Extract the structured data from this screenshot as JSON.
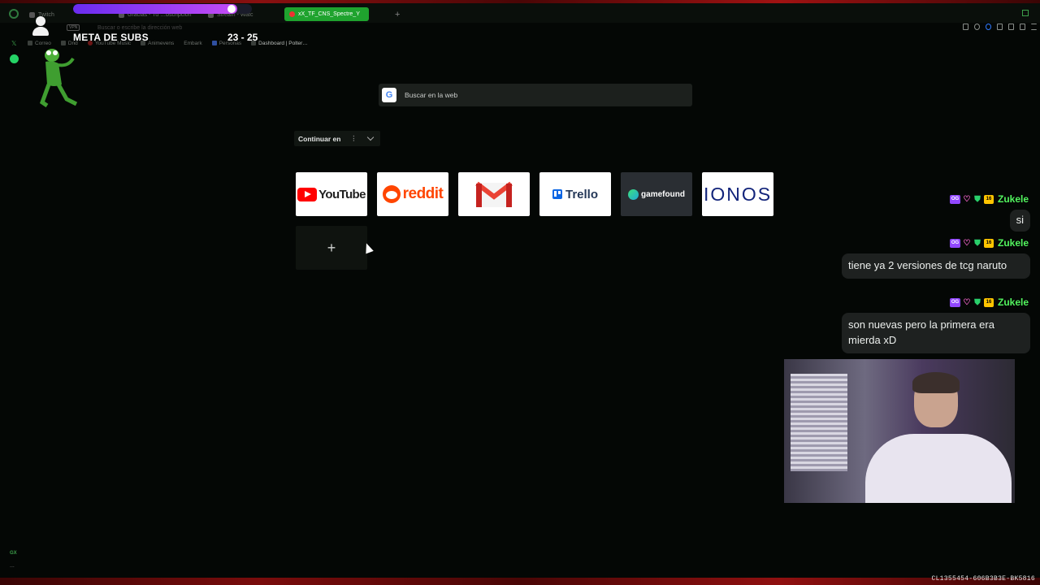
{
  "tabs": [
    {
      "label": "Twitch",
      "active": false
    },
    {
      "label": "Gracias - Tu …bscripción",
      "active": false
    },
    {
      "label": "Stream - Watc",
      "active": false
    },
    {
      "label": "xX_TF_CNS_Spectre_Y",
      "active": true
    }
  ],
  "overlay": {
    "meta_label": "META DE SUBS",
    "meta_count": "23 - 25",
    "meta_progress": 0.92
  },
  "address": {
    "vpn": "VPN",
    "placeholder": "Buscar o escribe la dirección web"
  },
  "bookmarks": [
    {
      "label": "Correo"
    },
    {
      "label": "Dnd"
    },
    {
      "label": "YouTube Music"
    },
    {
      "label": "Animevens"
    },
    {
      "label": "Embark"
    },
    {
      "label": "Personas"
    },
    {
      "label": "Dashboard | Polter…"
    }
  ],
  "search": {
    "placeholder": "Buscar en la web",
    "engine_letter": "G"
  },
  "continue": {
    "label": "Continuar en"
  },
  "speed_dials": [
    {
      "name": "YouTube",
      "brand_color": "#ff0000"
    },
    {
      "name": "reddit",
      "brand_color": "#ff4500"
    },
    {
      "name": "Gmail",
      "brand_color": "#ea4335"
    },
    {
      "name": "Trello",
      "brand_color": "#0c66e4"
    },
    {
      "name": "gamefound",
      "brand_color": "#3de07c"
    },
    {
      "name": "IONOS",
      "brand_color": "#11237a"
    }
  ],
  "add_dial": {
    "label": "+"
  },
  "chat": [
    {
      "user": "Zukele",
      "badge_og": "OG",
      "badge_sub": "16",
      "message": "si"
    },
    {
      "user": "Zukele",
      "badge_og": "OG",
      "badge_sub": "16",
      "message": "tiene ya 2 versiones de tcg naruto"
    },
    {
      "user": "Zukele",
      "badge_og": "OG",
      "badge_sub": "16",
      "message": "son nuevas pero la primera era mierda xD"
    }
  ],
  "sidebar": {
    "gx_label": "GX",
    "more": "..."
  },
  "footer_code": "CL1355454-606B3B3E-BK5816",
  "colors": {
    "accent_green": "#1fa32e",
    "chat_name": "#52f45e",
    "meta_purple": "#9147ff",
    "border_red": "#8a1010"
  }
}
